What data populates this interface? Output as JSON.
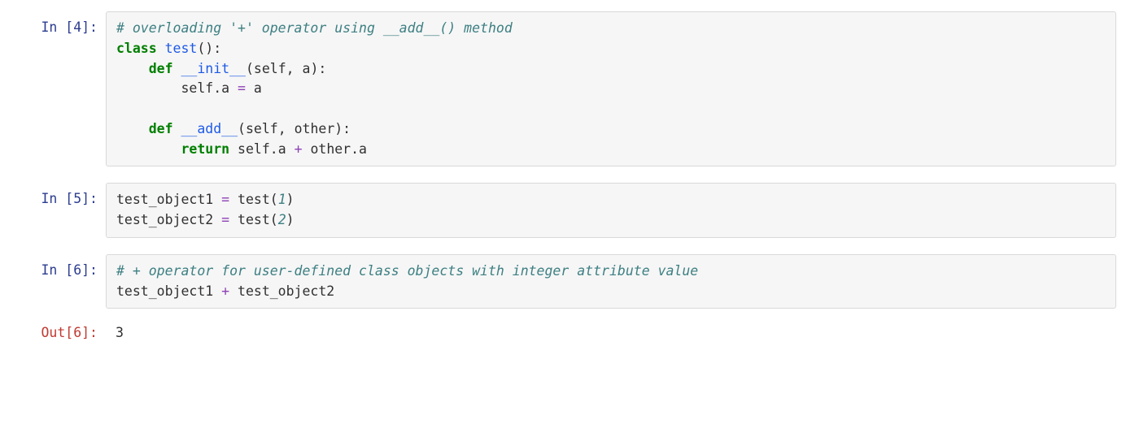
{
  "cells": [
    {
      "prompt_type": "in",
      "prompt_label": "In [4]:",
      "code_tokens": [
        {
          "cls": "c",
          "text": "# overloading '+' operator using __add__() method"
        },
        {
          "cls": "nor",
          "text": "\n"
        },
        {
          "cls": "kw",
          "text": "class"
        },
        {
          "cls": "nor",
          "text": " "
        },
        {
          "cls": "fn",
          "text": "test"
        },
        {
          "cls": "nor",
          "text": "():\n    "
        },
        {
          "cls": "kw",
          "text": "def"
        },
        {
          "cls": "nor",
          "text": " "
        },
        {
          "cls": "fn",
          "text": "__init__"
        },
        {
          "cls": "nor",
          "text": "(self, a):\n        self.a "
        },
        {
          "cls": "op",
          "text": "="
        },
        {
          "cls": "nor",
          "text": " a\n\n    "
        },
        {
          "cls": "kw",
          "text": "def"
        },
        {
          "cls": "nor",
          "text": " "
        },
        {
          "cls": "fn",
          "text": "__add__"
        },
        {
          "cls": "nor",
          "text": "(self, other):\n        "
        },
        {
          "cls": "kw",
          "text": "return"
        },
        {
          "cls": "nor",
          "text": " self.a "
        },
        {
          "cls": "op",
          "text": "+"
        },
        {
          "cls": "nor",
          "text": " other.a"
        }
      ]
    },
    {
      "prompt_type": "in",
      "prompt_label": "In [5]:",
      "code_tokens": [
        {
          "cls": "nor",
          "text": "test_object1 "
        },
        {
          "cls": "op",
          "text": "="
        },
        {
          "cls": "nor",
          "text": " test("
        },
        {
          "cls": "c",
          "text": "1"
        },
        {
          "cls": "nor",
          "text": ")\ntest_object2 "
        },
        {
          "cls": "op",
          "text": "="
        },
        {
          "cls": "nor",
          "text": " test("
        },
        {
          "cls": "c",
          "text": "2"
        },
        {
          "cls": "nor",
          "text": ")"
        }
      ]
    },
    {
      "prompt_type": "in",
      "prompt_label": "In [6]:",
      "code_tokens": [
        {
          "cls": "c",
          "text": "# + operator for user-defined class objects with integer attribute value"
        },
        {
          "cls": "nor",
          "text": "\ntest_object1 "
        },
        {
          "cls": "op",
          "text": "+"
        },
        {
          "cls": "nor",
          "text": " test_object2"
        }
      ]
    },
    {
      "prompt_type": "out",
      "prompt_label": "Out[6]:",
      "output_text": "3"
    }
  ]
}
